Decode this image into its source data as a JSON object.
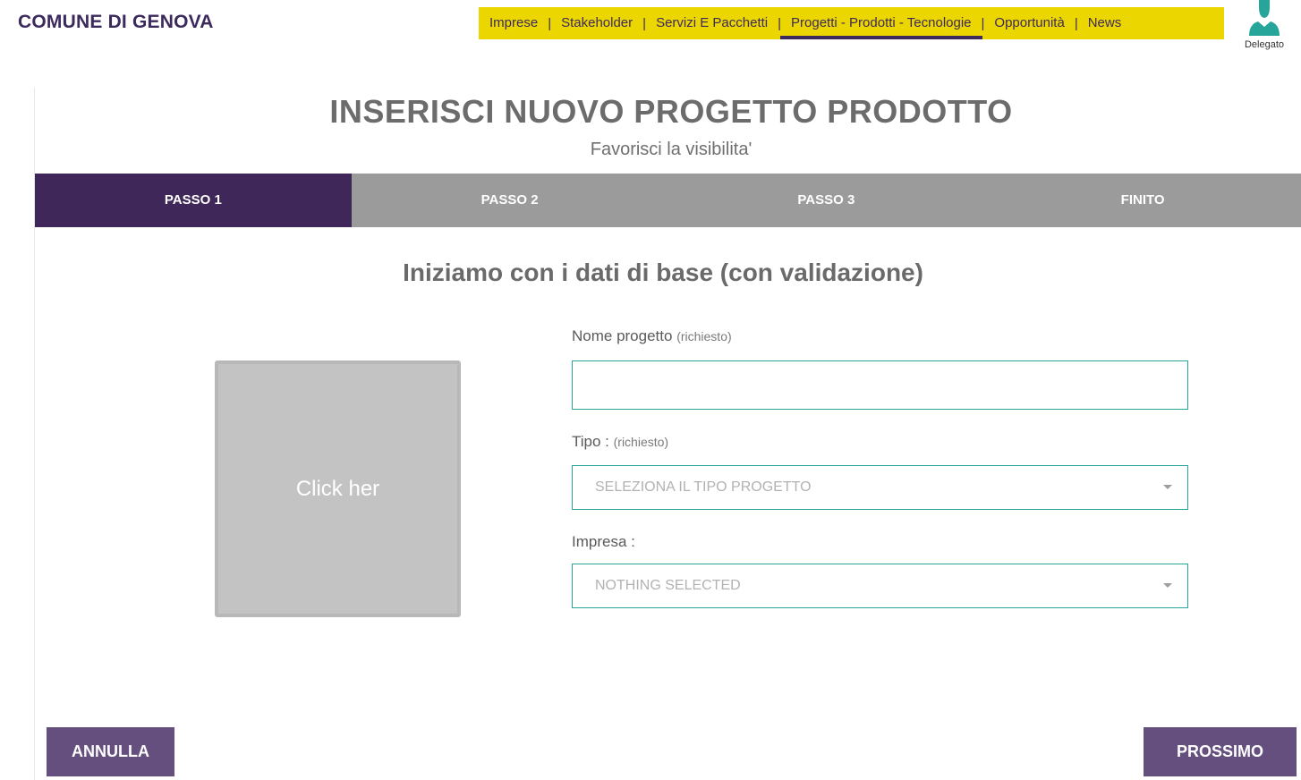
{
  "brand": "COMUNE DI GENOVA",
  "nav": {
    "items": [
      {
        "label": "Imprese"
      },
      {
        "label": "Stakeholder"
      },
      {
        "label": "Servizi E Pacchetti"
      },
      {
        "label": "Progetti - Prodotti - Tecnologie",
        "active": true
      },
      {
        "label": "Opportunità"
      },
      {
        "label": "News"
      }
    ],
    "separator": "|"
  },
  "user": {
    "label": "Delegato",
    "icon": "user-icon"
  },
  "header": {
    "title_strong": "INSERISCI",
    "title_rest": " NUOVO PROGETTO PRODOTTO",
    "subtitle": "Favorisci la visibilita'"
  },
  "steps": [
    {
      "label": "PASSO 1",
      "active": true
    },
    {
      "label": "PASSO 2"
    },
    {
      "label": "PASSO 3"
    },
    {
      "label": "FINITO"
    }
  ],
  "form": {
    "section_title": "Iniziamo con i dati di base (con validazione)",
    "image_upload_label": "Click her",
    "name": {
      "label": "Nome progetto",
      "required": "(richiesto)",
      "value": ""
    },
    "type": {
      "label": "Tipo :",
      "required": "(richiesto)",
      "value": "SELEZIONA IL TIPO PROGETTO"
    },
    "company": {
      "label": "Impresa :",
      "value": "NOTHING SELECTED"
    }
  },
  "buttons": {
    "cancel": "ANNULLA",
    "next": "PROSSIMO"
  },
  "colors": {
    "brand": "#3d2a5c",
    "nav_bg": "#ecd600",
    "step_active": "#3f2759",
    "step_bg": "#9b9b9b",
    "accent": "#26a69a",
    "button": "#654f7f"
  }
}
